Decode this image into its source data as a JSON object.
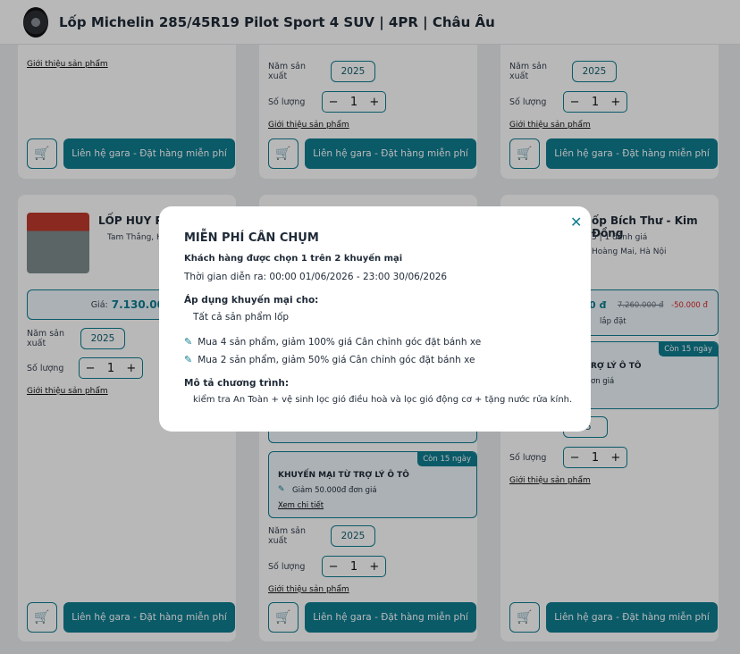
{
  "header": {
    "title": "Lốp Michelin 285/45R19 Pilot Sport 4 SUV | 4PR | Châu Âu"
  },
  "common": {
    "year_label": "Năm sản xuất",
    "year_value": "2025",
    "qty_label": "Số lượng",
    "qty_value": "1",
    "qty_minus": "−",
    "qty_plus": "+",
    "intro_link": "Giới thiệu sản phẩm",
    "cta_label": "Liên hệ gara - Đặt hàng miễn phí",
    "cart_icon": "🛒"
  },
  "card_mid_left": {
    "shop_name": "LỐP HUY PH",
    "location": "Tam Thắng, Hồ",
    "price_label": "Giá:",
    "price_value": "7.130.000"
  },
  "card_mid_right": {
    "shop_name": "ốp Bích Thư - Kim Đồng",
    "rating": "5 | 1 đánh giá",
    "address": "Hoàng Mai, Hà Nội",
    "price_partial": "0 đ",
    "old_price": "7.260.000 đ",
    "discount": "-50.000 đ",
    "install_note": "lắp đặt",
    "promo_tag": "Còn 15 ngày",
    "promo_title": "RỢ LÝ Ô TÔ",
    "promo_detail": "ơn giá",
    "year_partial": "25"
  },
  "card_bot_center": {
    "promo_tag": "Còn 15 ngày",
    "promo_title": "KHUYẾN MẠI TỪ TRỢ LÝ Ô TÔ",
    "promo_detail": "Giảm 50.000đ đơn giá",
    "promo_link": "Xem chi tiết",
    "partial_link": "Xem chi tiết"
  },
  "modal": {
    "close_icon": "✕",
    "title": "MIỄN PHÍ CÂN CHỤM",
    "subtitle": "Khách hàng được chọn 1 trên 2 khuyến mại",
    "time": "Thời gian diễn ra: 00:00 01/06/2026 - 23:00 30/06/2026",
    "apply_heading": "Áp dụng khuyến mại cho:",
    "apply_value": "Tất cả sản phẩm lốp",
    "offers": [
      "Mua 4 sản phẩm, giảm 100% giá Cân chỉnh góc đặt bánh xe",
      "Mua 2 sản phẩm, giảm 50% giá Cân chỉnh góc đặt bánh xe"
    ],
    "desc_heading": "Mô tả chương trình:",
    "desc_value": "kiểm tra An Toàn + vệ sinh lọc gió điều hoà và lọc gió động cơ + tặng nước rửa kính."
  }
}
